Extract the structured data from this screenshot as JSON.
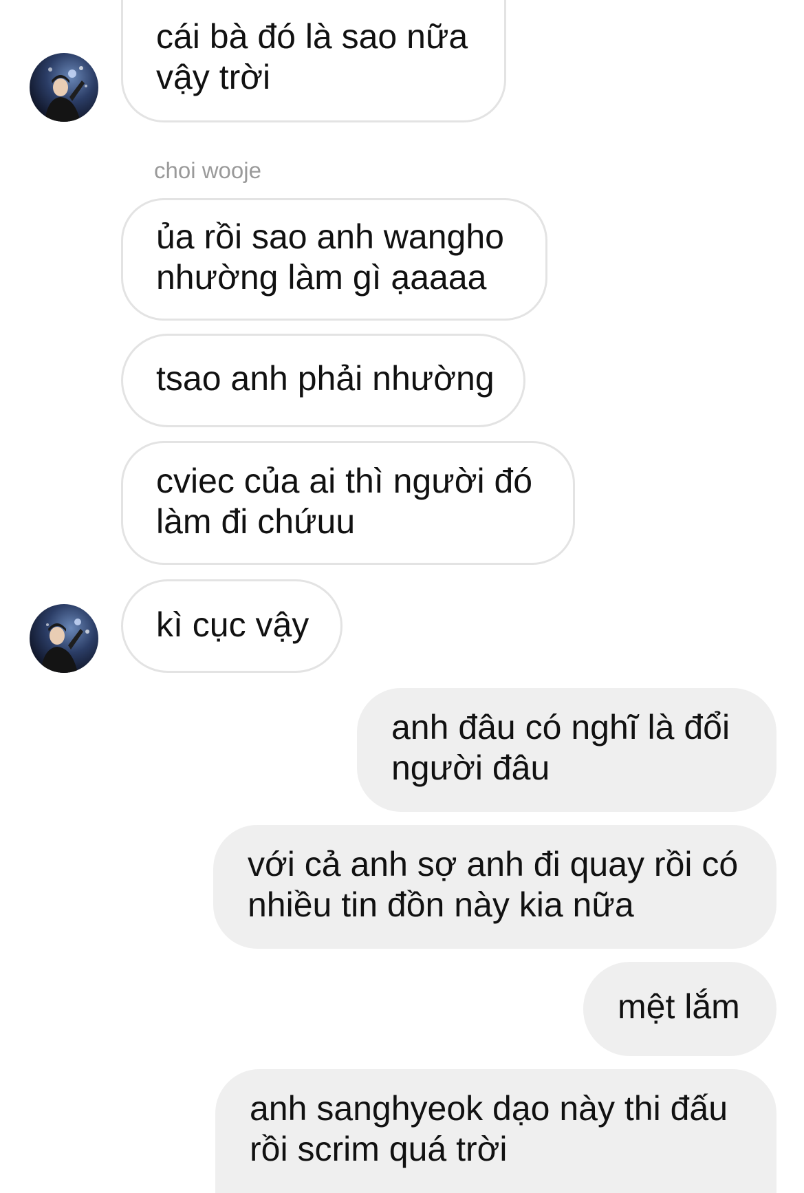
{
  "sender_name": "choi wooje",
  "messages": [
    {
      "direction": "incoming",
      "lines": [
        "cái bà đó là sao nữa",
        "vậy trời"
      ]
    },
    {
      "direction": "incoming",
      "lines": [
        "ủa rồi sao anh wangho",
        "nhường làm gì ạaaaa"
      ]
    },
    {
      "direction": "incoming",
      "lines": [
        "tsao anh phải nhường"
      ]
    },
    {
      "direction": "incoming",
      "lines": [
        "cviec của ai thì người đó",
        "làm đi chứuu"
      ]
    },
    {
      "direction": "incoming",
      "lines": [
        "kì cục vậy"
      ]
    },
    {
      "direction": "outgoing",
      "lines": [
        "anh đâu có nghĩ là đổi",
        "người đâu"
      ]
    },
    {
      "direction": "outgoing",
      "lines": [
        "với cả anh sợ anh đi quay rồi có",
        "nhiều tin đồn này kia nữa"
      ]
    },
    {
      "direction": "outgoing",
      "lines": [
        "mệt lắm"
      ]
    },
    {
      "direction": "outgoing",
      "lines": [
        "anh sanghyeok dạo này thi đấu",
        "rồi scrim quá trời"
      ]
    }
  ],
  "colors": {
    "incoming_bubble_bg": "#ffffff",
    "incoming_bubble_border": "#e3e3e3",
    "outgoing_bubble_bg": "#efefef",
    "text": "#111111",
    "sender_name": "#9a9a9a"
  },
  "icons": {
    "avatar": "profile-photo-avatar"
  }
}
